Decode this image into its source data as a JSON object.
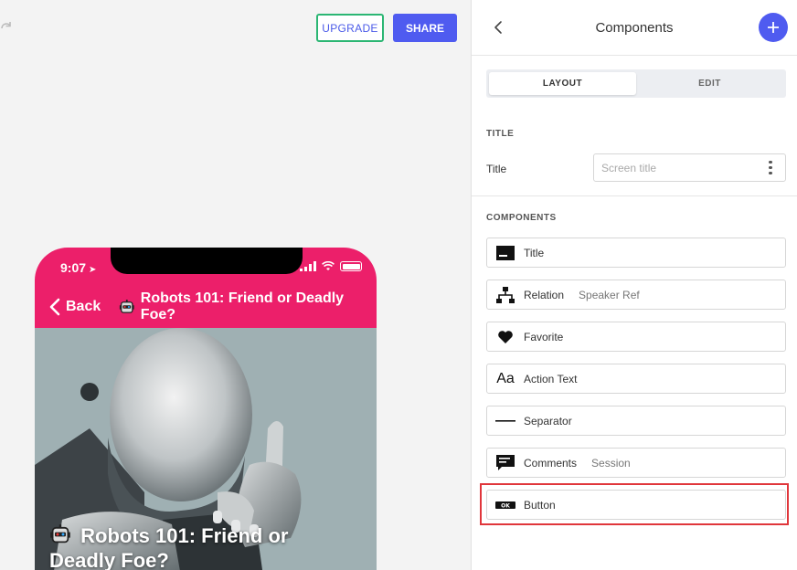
{
  "toolbar": {
    "upgrade_label": "UPGRADE",
    "share_label": "SHARE"
  },
  "phone": {
    "time": "9:07",
    "nav": {
      "back_label": "Back",
      "title": "Robots 101: Friend or Deadly Foe?"
    },
    "hero_title": "Robots 101: Friend or Deadly Foe?"
  },
  "panel": {
    "title": "Components",
    "tabs": [
      {
        "label": "LAYOUT",
        "active": true
      },
      {
        "label": "EDIT",
        "active": false
      }
    ],
    "title_section": {
      "heading": "TITLE",
      "field_label": "Title",
      "placeholder": "Screen title",
      "value": ""
    },
    "components_heading": "COMPONENTS",
    "components": [
      {
        "icon": "title-icon",
        "label": "Title",
        "sub": ""
      },
      {
        "icon": "hierarchy-icon",
        "label": "Relation",
        "sub": "Speaker Ref"
      },
      {
        "icon": "heart-icon",
        "label": "Favorite",
        "sub": ""
      },
      {
        "icon": "text-aa-icon",
        "label": "Action Text",
        "sub": ""
      },
      {
        "icon": "line-icon",
        "label": "Separator",
        "sub": ""
      },
      {
        "icon": "comment-icon",
        "label": "Comments",
        "sub": "Session"
      },
      {
        "icon": "ok-button-icon",
        "label": "Button",
        "sub": ""
      }
    ]
  },
  "colors": {
    "accent": "#4f5bf0",
    "phone_header": "#ec1f6a",
    "upgrade_border": "#2bb673",
    "highlight": "#e0363b"
  }
}
